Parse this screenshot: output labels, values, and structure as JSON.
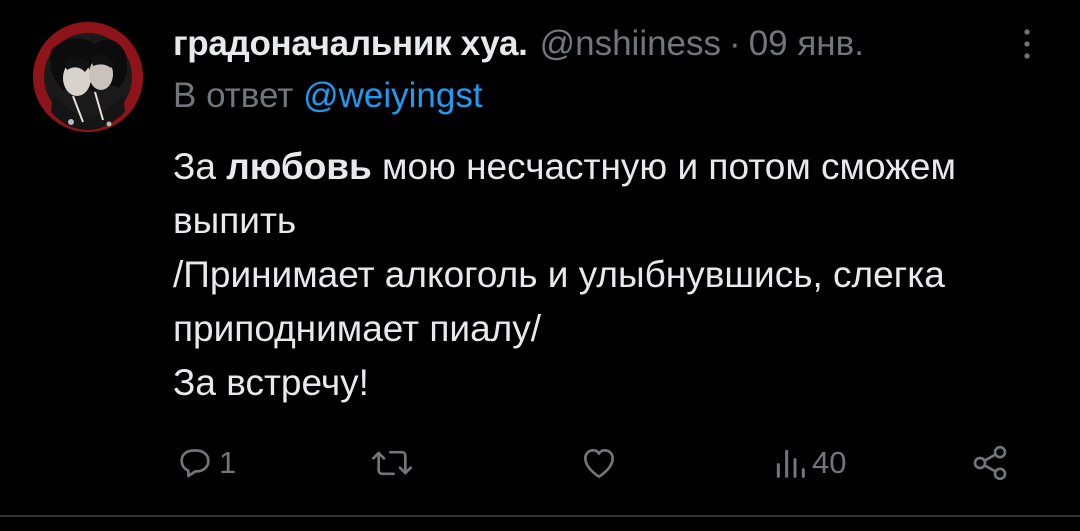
{
  "tweet": {
    "display_name": "градоначальник хуа.",
    "handle": "@nshiiness",
    "separator": "·",
    "date": "09 янв.",
    "reply_prefix": "В ответ",
    "reply_to": "@weiyingst",
    "text": {
      "line1_start": "За ",
      "line1_bold": "любовь",
      "line1_end": " мою несчастную и потом сможем",
      "line2": "выпить",
      "line3": "/Принимает алкоголь и улыбнувшись, слегка",
      "line4": "приподнимает пиалу/",
      "line5": "За встречу!"
    }
  },
  "actions": {
    "reply_icon": "reply-bubble-icon",
    "reply_count": "1",
    "retweet_icon": "retweet-icon",
    "retweet_count": "",
    "like_icon": "heart-icon",
    "like_count": "",
    "views_icon": "views-bar-chart-icon",
    "views_count": "40",
    "share_icon": "share-icon"
  },
  "colors": {
    "background": "#000000",
    "primary_text": "#e7e9ea",
    "secondary_text": "#71767b",
    "link": "#1d9bf0",
    "avatar_bg": "#8f1419",
    "divider": "#2f3336"
  }
}
